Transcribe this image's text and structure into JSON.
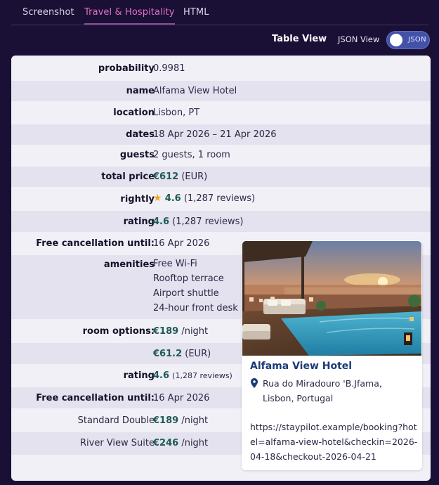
{
  "tabs": [
    "Screenshot",
    "Travel & Hospitality",
    "HTML"
  ],
  "view_toggle": {
    "table_label": "Table View",
    "json_label": "JSON View",
    "toggle_text": "JSON"
  },
  "fields": {
    "probability": {
      "key": "probability",
      "value": "0.9981"
    },
    "name": {
      "key": "name",
      "value": "Alfama View Hotel"
    },
    "location": {
      "key": "location",
      "value": "Lisbon, PT"
    },
    "dates": {
      "key": "dates",
      "value": "18 Apr 2026 – 21 Apr 2026"
    },
    "guests": {
      "key": "guests",
      "value": "2 guests, 1 room"
    },
    "total_price": {
      "key": "total price",
      "amount": "€612",
      "currency": "(EUR)"
    },
    "rightly": {
      "key": "rightly",
      "score": "4.6",
      "reviews": "(1,287 reviews)"
    },
    "rating": {
      "key": "rating",
      "score": "4.6",
      "reviews": "(1,287 reviews)"
    },
    "free_cancellation": {
      "key": "Free cancellation until:",
      "value": "16 Apr 2026"
    },
    "amenities": {
      "key": "amenities",
      "items": [
        "Free Wi-Fi",
        "Rooftop terrace",
        "Airport shuttle",
        "24-hour front desk"
      ]
    },
    "room_options": {
      "key": "room options:",
      "price": "€189",
      "unit": "/night"
    },
    "extra_price": {
      "amount": "€61.2",
      "currency": "(EUR)"
    },
    "rating2": {
      "key": "rating",
      "score": "4.6",
      "reviews": "(1,287 reviews)"
    },
    "free_cancellation2": {
      "key": "Free cancellation until:",
      "value": "16 Apr 2026"
    },
    "standard_double": {
      "key": "Standard Double",
      "price": "€189",
      "unit": "/night"
    },
    "river_view": {
      "key": "River View Suite",
      "price": "€246",
      "unit": "/night"
    }
  },
  "card": {
    "title": "Alfama View Hotel",
    "address_line1": "Rua do Miradouro 'B.Jfama,",
    "address_line2": "Lisbon, Portugal",
    "url": "https://staypilot.example/booking?hotel=alfama-view-hotel&checkin=2026-04-18&checkout-2026-04-21"
  },
  "colors": {
    "background": "#1a1035",
    "active_tab": "#e36fc4",
    "toggle": "#4352a9",
    "price": "#1e5a56",
    "card_title": "#1c3a7a",
    "star": "#f0a51a"
  },
  "icons": [
    "star-icon",
    "location-pin-icon"
  ]
}
